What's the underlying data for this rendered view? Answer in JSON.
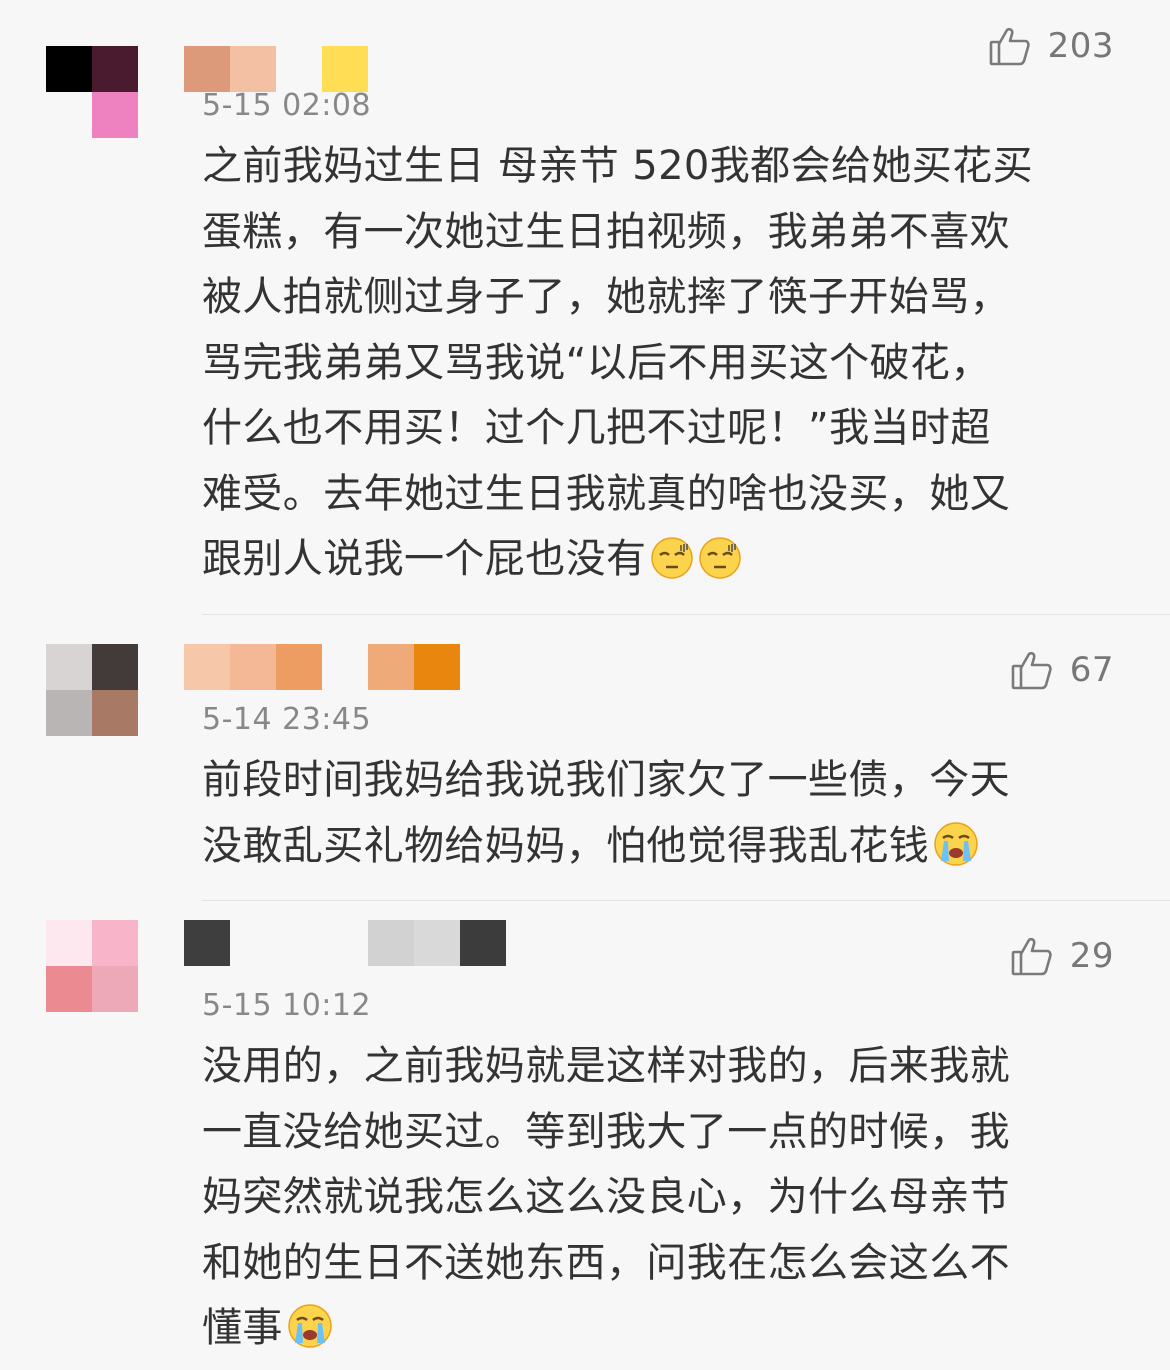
{
  "comments": [
    {
      "like_count": "203",
      "time": "5-15 02:08",
      "text_lines": [
        "之前我妈过生日 母亲节 520我都会给她买花买",
        "蛋糕，有一次她过生日拍视频，我弟弟不喜欢",
        "被人拍就侧过身子了，她就摔了筷子开始骂，",
        "骂完我弟弟又骂我说“以后不用买这个破花，",
        "什么也不用买！过个几把不过呢！”我当时超",
        "难受。去年她过生日我就真的啥也没买，她又",
        "跟别人说我一个屁也没有"
      ],
      "emojis": [
        "sweat-face-emoji",
        "sweat-face-emoji"
      ]
    },
    {
      "like_count": "67",
      "time": "5-14 23:45",
      "text_lines": [
        "前段时间我妈给我说我们家欠了一些债，今天",
        "没敢乱买礼物给妈妈，怕他觉得我乱花钱"
      ],
      "emojis": [
        "crying-face-emoji"
      ]
    },
    {
      "like_count": "29",
      "time": "5-15 10:12",
      "text_lines": [
        "没用的，之前我妈就是这样对我的，后来我就",
        "一直没给她买过。等到我大了一点的时候，我",
        "妈突然就说我怎么这么没良心，为什么母亲节",
        "和她的生日不送她东西，问我在怎么会这么不",
        "懂事"
      ],
      "emojis": [
        "crying-face-emoji"
      ]
    }
  ],
  "colors": {
    "background": "#f7f7f7",
    "text": "#333333",
    "meta": "#888888",
    "divider": "#e3e3e3"
  },
  "icons": {
    "like": "thumbs-up-icon"
  }
}
